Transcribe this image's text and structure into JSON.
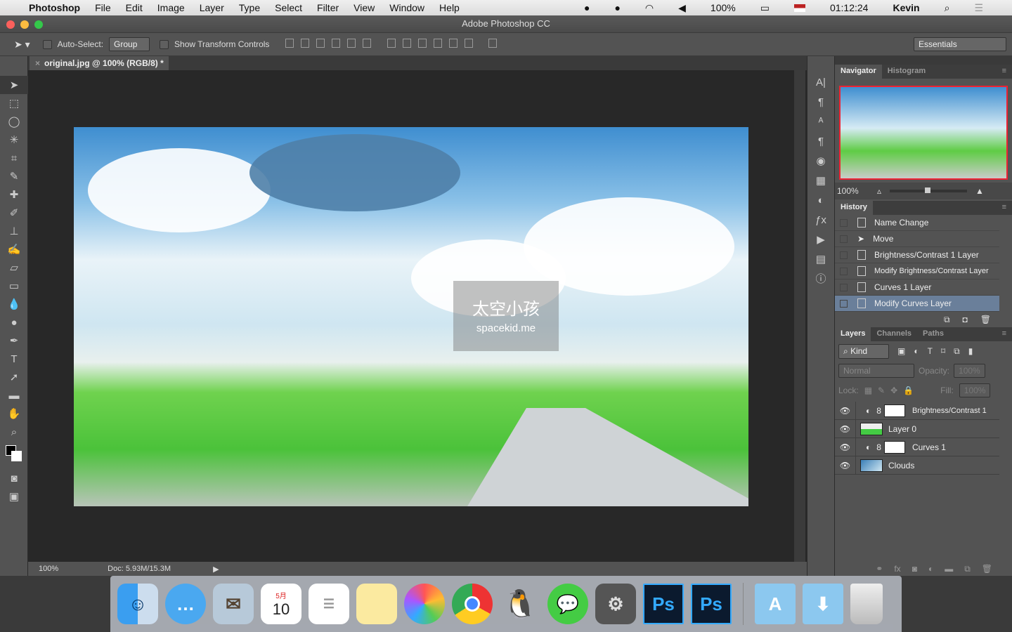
{
  "menubar": {
    "app": "Photoshop",
    "items": [
      "File",
      "Edit",
      "Image",
      "Layer",
      "Type",
      "Select",
      "Filter",
      "View",
      "Window",
      "Help"
    ],
    "battery": "100%",
    "time": "01:12:24",
    "user": "Kevin"
  },
  "window": {
    "title": "Adobe Photoshop CC"
  },
  "options": {
    "auto_select": "Auto-Select:",
    "group": "Group",
    "show_transform": "Show Transform Controls",
    "workspace": "Essentials"
  },
  "document": {
    "tab": "original.jpg @ 100% (RGB/8) *",
    "watermark_cn": "太空小孩",
    "watermark_en": "spacekid.me"
  },
  "status": {
    "zoom": "100%",
    "doc": "Doc: 5.93M/15.3M"
  },
  "navigator": {
    "tabs": [
      "Navigator",
      "Histogram"
    ],
    "zoom": "100%"
  },
  "history": {
    "title": "History",
    "items": [
      "Name Change",
      "Move",
      "Brightness/Contrast 1 Layer",
      "Modify Brightness/Contrast Layer",
      "Curves 1 Layer",
      "Modify Curves Layer"
    ],
    "selected_index": 5
  },
  "layers": {
    "tabs": [
      "Layers",
      "Channels",
      "Paths"
    ],
    "kind": "Kind",
    "blend": "Normal",
    "opacity_label": "Opacity:",
    "opacity": "100%",
    "lock_label": "Lock:",
    "fill_label": "Fill:",
    "fill": "100%",
    "items": [
      "Brightness/Contrast 1",
      "Layer 0",
      "Curves 1",
      "Clouds"
    ]
  },
  "dock": {
    "ps": "Ps",
    "calendar_month": "5月",
    "calendar_day": "10"
  }
}
